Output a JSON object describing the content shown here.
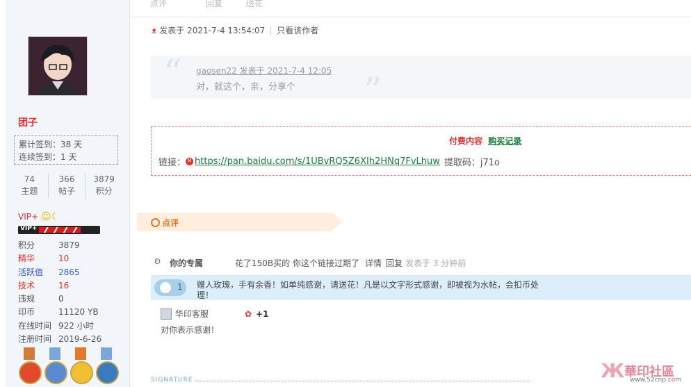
{
  "sidebar": {
    "username": "团子",
    "checkin": [
      "累计签到：38 天",
      "连续签到：1 天"
    ],
    "stats": [
      {
        "value": "74",
        "label": "主题"
      },
      {
        "value": "366",
        "label": "帖子"
      },
      {
        "value": "3879",
        "label": "积分"
      }
    ],
    "vip_label": "VIP+",
    "vip_bar_label": "VIP+",
    "attributes": [
      {
        "key": "积分",
        "value": "3879",
        "key_color": "#555555",
        "value_color": "#555555"
      },
      {
        "key": "精华",
        "value": "10",
        "key_color": "#e0312f",
        "value_color": "#e0312f"
      },
      {
        "key": "活跃值",
        "value": "2865",
        "key_color": "#3a5bd9",
        "value_color": "#3a5bd9"
      },
      {
        "key": "技术",
        "value": "16",
        "key_color": "#e0312f",
        "value_color": "#e0312f"
      },
      {
        "key": "违规",
        "value": "0",
        "key_color": "#555555",
        "value_color": "#555555"
      },
      {
        "key": "印币",
        "value": "11120 YB",
        "key_color": "#555555",
        "value_color": "#555555"
      },
      {
        "key": "在线时间",
        "value": "922 小时",
        "key_color": "#555555",
        "value_color": "#555555"
      },
      {
        "key": "注册时间",
        "value": "2019-6-26",
        "key_color": "#555555",
        "value_color": "#555555"
      }
    ]
  },
  "topbar": {
    "items": [
      "点评",
      "回复",
      "送花"
    ]
  },
  "post": {
    "posted_at": "发表于 2021-7-4 13:54:07",
    "author_only": "只看该作者",
    "quote": {
      "attribution": "gaosen22 发表于 2021-7-4 12:05",
      "text": "对，就这个，亲，分享个"
    },
    "paid": {
      "title": "付费内容",
      "purchase_link": "购买记录",
      "link_label": "链接：",
      "url": "https://pan.baidu.com/s/1UBvRQ5Z6XIh2HNq7FvLhuw",
      "code": "提取码：j71o"
    }
  },
  "rating": {
    "title": "点评"
  },
  "comment": {
    "user": "你的专属",
    "text": "花了150B买的 你这个链接过期了",
    "detail": "详情",
    "reply": "回复",
    "time": "发表于 3 分钟前"
  },
  "flower": {
    "count": "1",
    "text": "赠人玫瑰，手有余香！如单纯感谢，请送花！凡是以文字形式感谢，即被视为水帖，会扣币处理！"
  },
  "rater": {
    "name": "华印客服",
    "plus": "+1",
    "message": "对你表示感谢！"
  },
  "signature_label": "SIGNATURE",
  "watermark": {
    "title": "華印社區",
    "url": "www.52cnp.com"
  }
}
